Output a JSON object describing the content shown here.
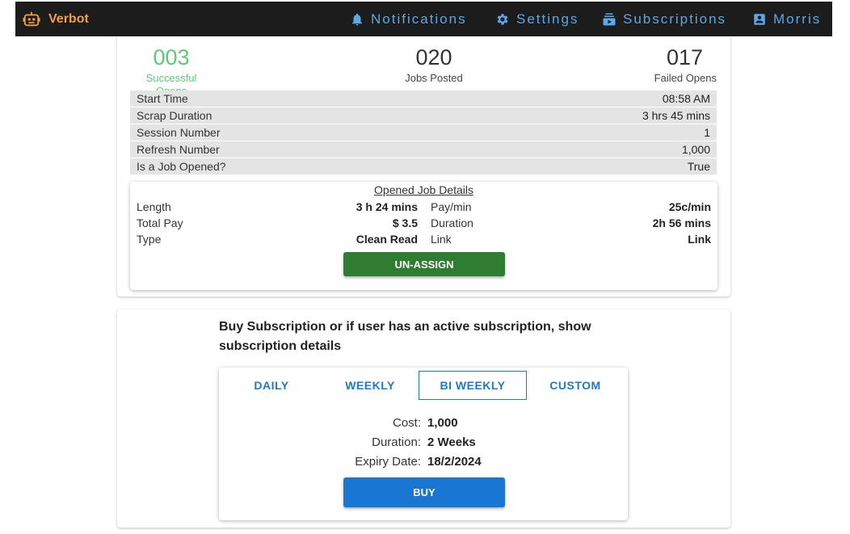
{
  "nav": {
    "brand": "Verbot",
    "brand_color": "#f59e42",
    "link_color": "#5aa9e6",
    "items": [
      {
        "label": "Notifications",
        "icon": "bell-icon"
      },
      {
        "label": "Settings",
        "icon": "gear-icon"
      },
      {
        "label": "Subscriptions",
        "icon": "subscriptions-icon"
      },
      {
        "label": "Morris",
        "icon": "account-box-icon"
      }
    ]
  },
  "stats": {
    "successful": {
      "value": "003",
      "label": "Successful Opens",
      "color": "#5ec87a"
    },
    "jobs": {
      "value": "020",
      "label": "Jobs Posted"
    },
    "failed": {
      "value": "017",
      "label": "Failed Opens"
    }
  },
  "session_info": [
    {
      "label": "Start Time",
      "value": "08:58 AM"
    },
    {
      "label": "Scrap Duration",
      "value": "3 hrs 45 mins"
    },
    {
      "label": "Session Number",
      "value": "1"
    },
    {
      "label": "Refresh Number",
      "value": "1,000"
    },
    {
      "label": "Is a Job Opened?",
      "value": "True"
    }
  ],
  "job": {
    "title": "Opened Job Details",
    "rows": [
      {
        "k1": "Length",
        "v1": "3 h 24 mins",
        "k2": "Pay/min",
        "v2": "25c/min"
      },
      {
        "k1": "Total Pay",
        "v1": "$ 3.5",
        "k2": "Duration",
        "v2": "2h 56 mins"
      },
      {
        "k1": "Type",
        "v1": "Clean Read",
        "k2": "Link",
        "v2": "Link"
      }
    ],
    "unassign_label": "UN-ASSIGN",
    "unassign_color": "#2e7d32"
  },
  "subscription": {
    "heading": "Buy Subscription or if user has an active subscription, show subscription details",
    "tabs": [
      {
        "label": "DAILY",
        "active": false
      },
      {
        "label": "WEEKLY",
        "active": false
      },
      {
        "label": "BI WEEKLY",
        "active": true
      },
      {
        "label": "CUSTOM",
        "active": false
      }
    ],
    "details": [
      {
        "label": "Cost:",
        "value": "1,000"
      },
      {
        "label": "Duration:",
        "value": "2 Weeks"
      },
      {
        "label": "Expiry Date:",
        "value": "18/2/2024"
      }
    ],
    "buy_label": "BUY",
    "accent": "#1976d2"
  }
}
